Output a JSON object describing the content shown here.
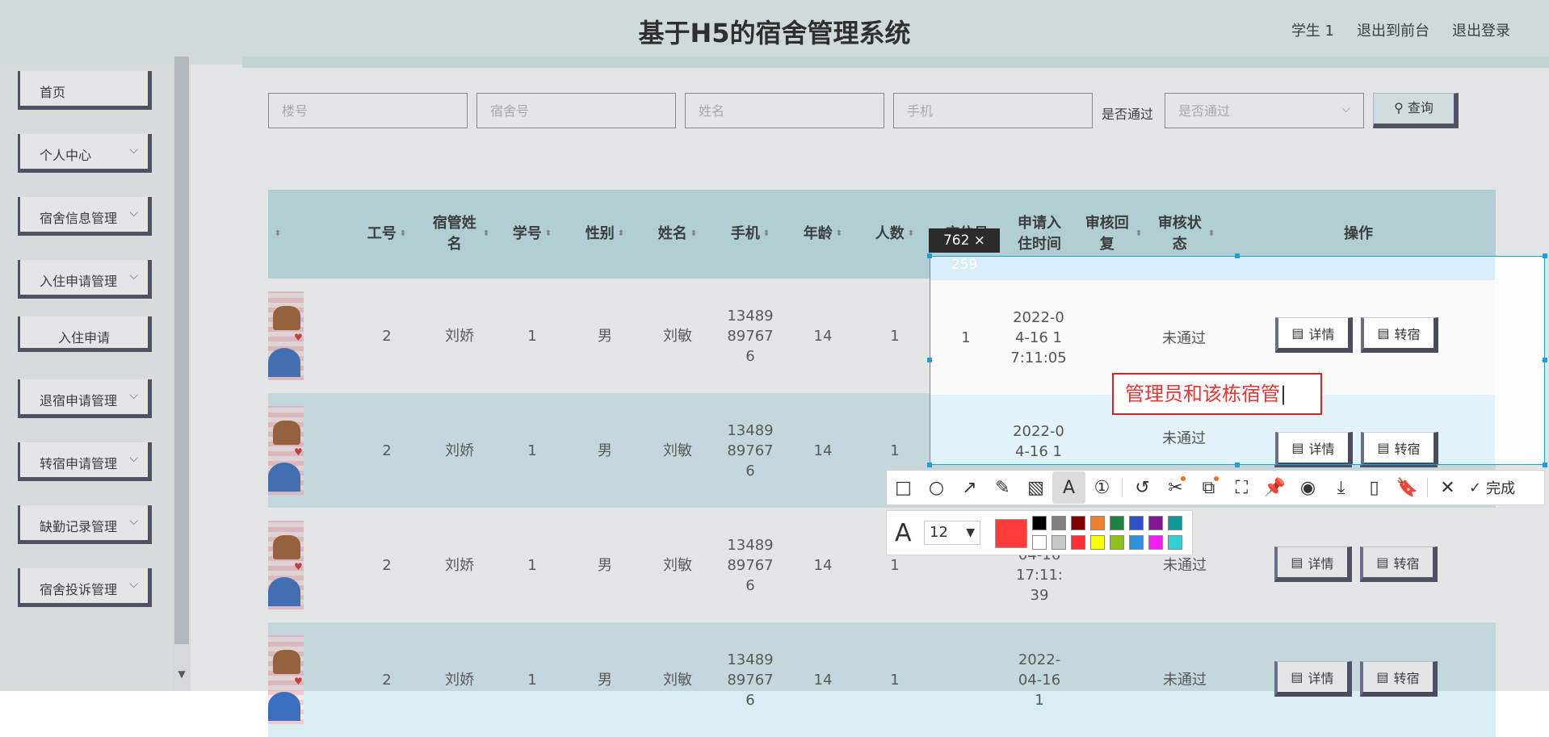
{
  "header": {
    "title": "基于H5的宿舍管理系统",
    "links": [
      "学生 1",
      "退出到前台",
      "退出登录"
    ]
  },
  "sidebar": {
    "items": [
      {
        "label": "首页",
        "has_chevron": false
      },
      {
        "label": "个人中心",
        "has_chevron": true
      },
      {
        "label": "宿舍信息管理",
        "has_chevron": true
      },
      {
        "label": "入住申请管理",
        "has_chevron": true
      },
      {
        "label": "入住申请",
        "has_chevron": false,
        "sub": true
      },
      {
        "label": "退宿申请管理",
        "has_chevron": true
      },
      {
        "label": "转宿申请管理",
        "has_chevron": true
      },
      {
        "label": "缺勤记录管理",
        "has_chevron": true
      },
      {
        "label": "宿舍投诉管理",
        "has_chevron": true
      }
    ]
  },
  "filters": {
    "building_placeholder": "楼号",
    "room_placeholder": "宿舍号",
    "name_placeholder": "姓名",
    "phone_placeholder": "手机",
    "passed_label": "是否通过",
    "passed_placeholder": "是否通过",
    "search_label": "查询"
  },
  "table": {
    "headers": {
      "job_no": "工号",
      "manager_name": "宿管姓名",
      "student_no": "学号",
      "gender": "性别",
      "name": "姓名",
      "phone": "手机",
      "age": "年龄",
      "count": "人数",
      "bed_no": "床位号",
      "apply_time": "申请入住时间",
      "reply": "审核回复",
      "status": "审核状态",
      "actions": "操作"
    },
    "rows": [
      {
        "job_no": "2",
        "manager_name": "刘娇",
        "student_no": "1",
        "gender": "男",
        "name": "刘敏",
        "phone": "13489897676",
        "age": "14",
        "count": "1",
        "bed_no": "1",
        "apply_time": "2022-04-16 17:11:05",
        "reply": "",
        "status": "未通过"
      },
      {
        "job_no": "2",
        "manager_name": "刘娇",
        "student_no": "1",
        "gender": "男",
        "name": "刘敏",
        "phone": "13489897676",
        "age": "14",
        "count": "1",
        "bed_no": "",
        "apply_time": "2022-04-16 17:11:22",
        "reply": "",
        "status": "未通过"
      },
      {
        "job_no": "2",
        "manager_name": "刘娇",
        "student_no": "1",
        "gender": "男",
        "name": "刘敏",
        "phone": "13489897676",
        "age": "14",
        "count": "1",
        "bed_no": "",
        "apply_time": "2022-04-16 17:11:39",
        "reply": "",
        "status": "未通过"
      },
      {
        "job_no": "2",
        "manager_name": "刘娇",
        "student_no": "1",
        "gender": "男",
        "name": "刘敏",
        "phone": "13489897676",
        "age": "14",
        "count": "1",
        "bed_no": "",
        "apply_time": "2022-04-16 1",
        "reply": "",
        "status": "未通过"
      }
    ],
    "detail_label": "详情",
    "transfer_label": "转宿"
  },
  "screenshot_tool": {
    "size_label": "762 × 259",
    "annotation_text": "管理员和该栋宿管",
    "font_size": "12",
    "done_label": "完成",
    "current_color": "#ff3b3b",
    "swatches_top": [
      "#000000",
      "#808080",
      "#800000",
      "#f08030",
      "#208040",
      "#3050c8",
      "#801890",
      "#109898"
    ],
    "swatches_bottom": [
      "#ffffff",
      "#c8c8c8",
      "#ff3030",
      "#ffff00",
      "#90c020",
      "#3090e0",
      "#f020f0",
      "#30d0d8"
    ]
  }
}
